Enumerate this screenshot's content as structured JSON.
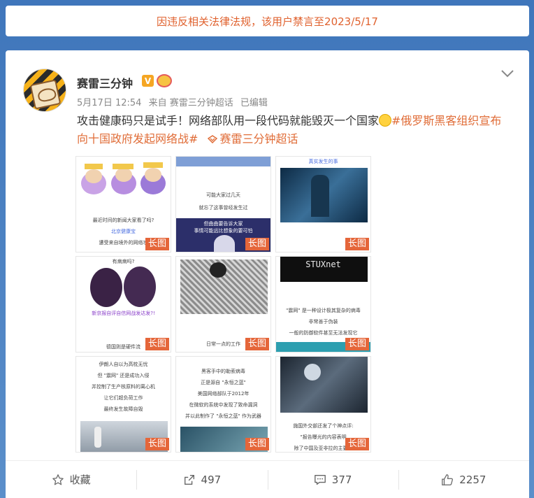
{
  "ban_notice": "因违反相关法律法规，该用户禁言至2023/5/17",
  "post": {
    "author": "赛雷三分钟",
    "verified_mark": "V",
    "date": "5月17日 12:54",
    "source": "来自 赛雷三分钟超话",
    "edited": "已编辑",
    "text_main": "攻击健康码只是试手！网络部队用一段代码就能毁灭一个国家",
    "topic": "#俄罗斯黑客组织宣布向十国政府发起网络战#",
    "supertopic": "赛雷三分钟超话",
    "image_tag": "长图",
    "images": [
      {
        "captions": [
          "最近时间的新闻大家看了吗?",
          "北京健康宝",
          "遭受来自境外的网络攻"
        ]
      },
      {
        "captions": [
          "可能大家过几天",
          "就忘了这事曾经发生过",
          "但曲曲要告诉大家",
          "事情可能远比想象的要可怕"
        ]
      },
      {
        "captions": [
          "真实发生的事"
        ]
      },
      {
        "captions": [
          "有病病吗?",
          "新京报自评自信网战发达发?!",
          "德国则是硬件流"
        ]
      },
      {
        "captions": [
          "日常一点的工作"
        ]
      },
      {
        "captions": [
          "STUXnet",
          "\"震网\" 是一种设计极其复杂的病毒",
          "非常善于伪装",
          "一般的防御软件甚至无法发现它"
        ]
      },
      {
        "captions": [
          "伊朗人自以为高枕无忧",
          "但 \"震网\" 还是成功入侵",
          "并控制了生产核原料的离心机",
          "让它们超负荷工作",
          "最终发生故障自毁"
        ]
      },
      {
        "captions": [
          "黑客手中的勒索病毒",
          "正是源自 \"永恒之蓝\"",
          "美国网络部队于2012年",
          "在微软的系统中发现了致命漏洞",
          "并以此制作了 \"永恒之蓝\" 作为武器"
        ]
      },
      {
        "captions": [
          "施国外交部还发了个神点评:",
          "\"报告曝光的内容表明",
          "除了中国及亚非拉的主要发"
        ]
      }
    ]
  },
  "footer": {
    "favorite": "收藏",
    "repost": "497",
    "comment": "377",
    "like": "2257"
  }
}
